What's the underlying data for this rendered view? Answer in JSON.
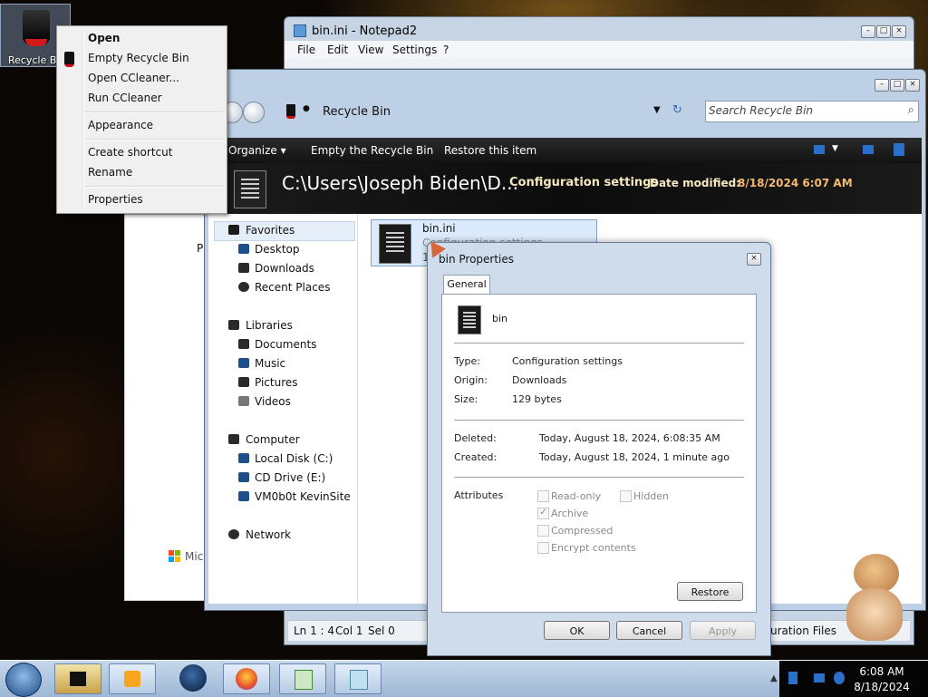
{
  "desktop": {
    "recycle_label": "Recycle Bin"
  },
  "context_menu": {
    "items": [
      "Open",
      "Empty Recycle Bin",
      "Open CCleaner...",
      "Run CCleaner",
      "Appearance",
      "Create shortcut",
      "Rename",
      "Properties"
    ]
  },
  "notepad": {
    "title": "bin.ini - Notepad2",
    "menu": [
      "File",
      "Edit",
      "View",
      "Settings",
      "?"
    ],
    "status": {
      "ln": "Ln 1 : 4",
      "col": "Col 1",
      "sel": "Sel 0",
      "right": "uration Files"
    }
  },
  "explorer": {
    "address": "Recycle Bin",
    "search_placeholder": "Search Recycle Bin",
    "commands": [
      "Organize",
      "Empty the Recycle Bin",
      "Restore this item"
    ],
    "details": {
      "path": "C:\\Users\\Joseph Biden\\D...",
      "type": "Configuration settings",
      "date_label": "Date modified:",
      "date_value": "8/18/2024 6:07 AM"
    },
    "nav": {
      "favorites": "Favorites",
      "desktop": "Desktop",
      "downloads": "Downloads",
      "recent": "Recent Places",
      "libraries": "Libraries",
      "documents": "Documents",
      "music": "Music",
      "pictures": "Pictures",
      "videos": "Videos",
      "computer": "Computer",
      "local_disk": "Local Disk (C:)",
      "cd_drive": "CD Drive (E:)",
      "vm": "VM0b0t KevinSite",
      "network": "Network"
    },
    "file": {
      "name": "bin.ini",
      "type": "Configuration settings",
      "size_frag": "1"
    }
  },
  "sheet": {
    "p": "P",
    "ms": "Mic"
  },
  "properties": {
    "title": "bin Properties",
    "tab": "General",
    "name": "bin",
    "type_label": "Type:",
    "type_value": "Configuration settings",
    "origin_label": "Origin:",
    "origin_value": "Downloads",
    "size_label": "Size:",
    "size_value": "129 bytes",
    "deleted_label": "Deleted:",
    "deleted_value": "Today, August 18, 2024, 6:08:35 AM",
    "created_label": "Created:",
    "created_value": "Today, August 18, 2024, 1 minute ago",
    "attributes_label": "Attributes",
    "read_only": "Read-only",
    "hidden": "Hidden",
    "archive": "Archive",
    "compressed": "Compressed",
    "encrypt": "Encrypt contents",
    "restore": "Restore",
    "ok": "OK",
    "cancel": "Cancel",
    "apply": "Apply",
    "archive_checked": true
  },
  "taskbar": {
    "time": "6:08 AM",
    "date": "8/18/2024"
  }
}
